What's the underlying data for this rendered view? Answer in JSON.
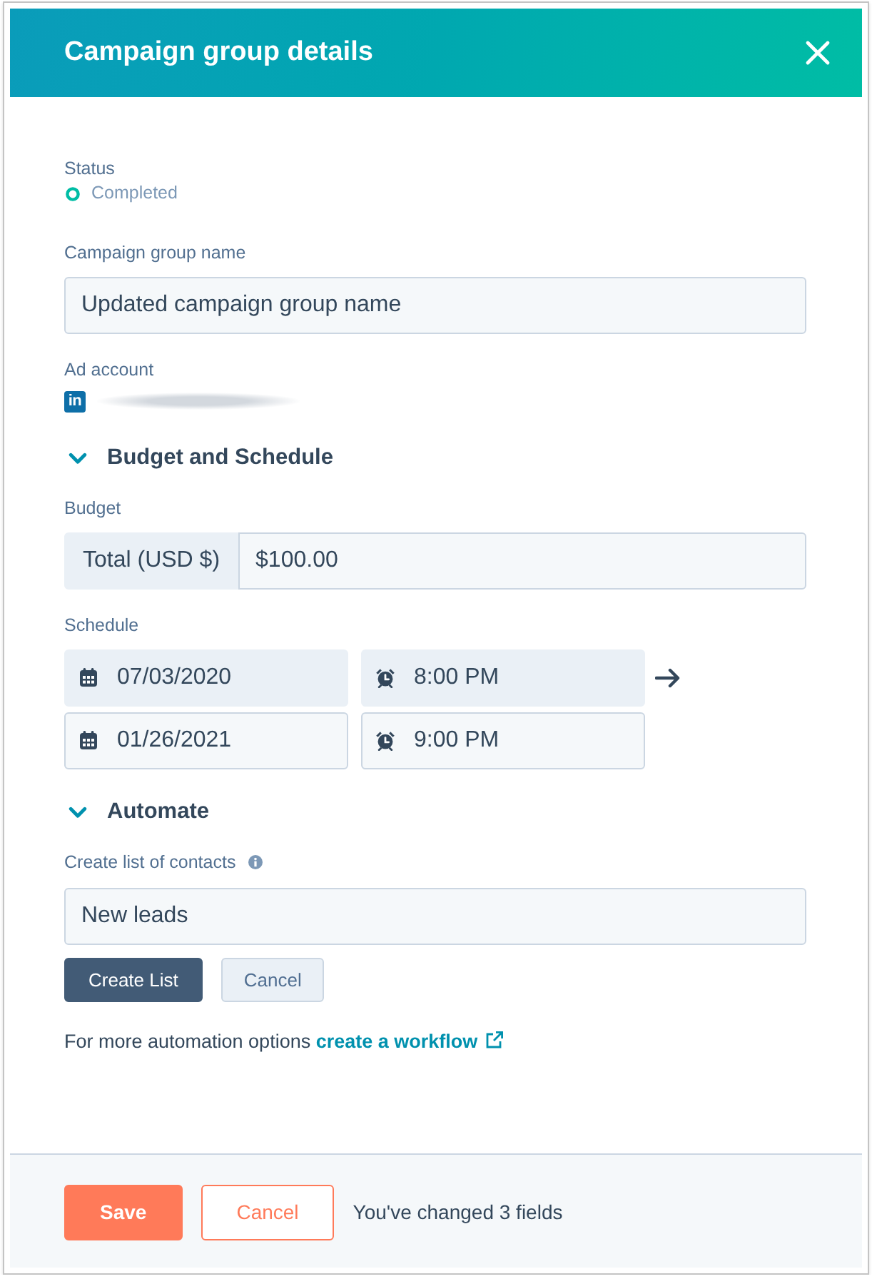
{
  "header": {
    "title": "Campaign group details"
  },
  "status": {
    "label": "Status",
    "value": "Completed",
    "color": "#00bda5"
  },
  "name_field": {
    "label": "Campaign group name",
    "value": "Updated campaign group name"
  },
  "ad_account": {
    "label": "Ad account",
    "network_logo": "in"
  },
  "budget_schedule": {
    "title": "Budget and Schedule",
    "expanded": true,
    "budget": {
      "label": "Budget",
      "addon": "Total (USD $)",
      "value": "$100.00"
    },
    "schedule": {
      "label": "Schedule",
      "rows": [
        {
          "date": "07/03/2020",
          "time": "8:00 PM",
          "disabled": true
        },
        {
          "date": "01/26/2021",
          "time": "9:00 PM",
          "disabled": false
        }
      ]
    }
  },
  "automate": {
    "title": "Automate",
    "expanded": true,
    "list_field": {
      "label": "Create list of contacts",
      "value": "New leads"
    },
    "buttons": [
      {
        "label": "Create List",
        "kind": "primary"
      },
      {
        "label": "Cancel",
        "kind": "secondary"
      }
    ],
    "note": {
      "text": "For more automation options",
      "link": "create a workflow"
    }
  },
  "footer": {
    "buttons": [
      {
        "label": "Save",
        "kind": "primary"
      },
      {
        "label": "Cancel",
        "kind": "secondary"
      }
    ],
    "message": "You've changed 3 fields"
  }
}
